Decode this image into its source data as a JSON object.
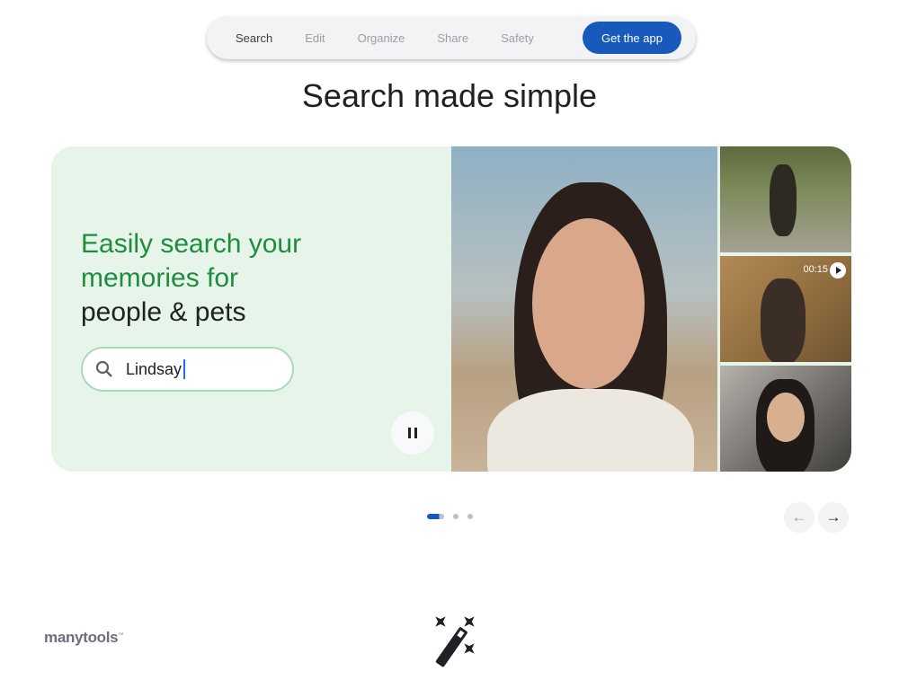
{
  "nav": {
    "tabs": [
      {
        "label": "Search",
        "active": true
      },
      {
        "label": "Edit"
      },
      {
        "label": "Organize"
      },
      {
        "label": "Share"
      },
      {
        "label": "Safety"
      }
    ],
    "cta": "Get the app"
  },
  "title": "Search made simple",
  "card": {
    "headline_green_1": "Easily search your",
    "headline_green_2": "memories for",
    "headline_dark": "people & pets",
    "search_value": "Lindsay",
    "video_duration": "00:15"
  },
  "carousel": {
    "slides": 3,
    "active_slide": 1
  },
  "logo": {
    "text": "manytools",
    "tm": "™"
  },
  "colors": {
    "accent": "#185abc",
    "green": "#1e8e3e",
    "card_bg": "#e6f4ea"
  }
}
